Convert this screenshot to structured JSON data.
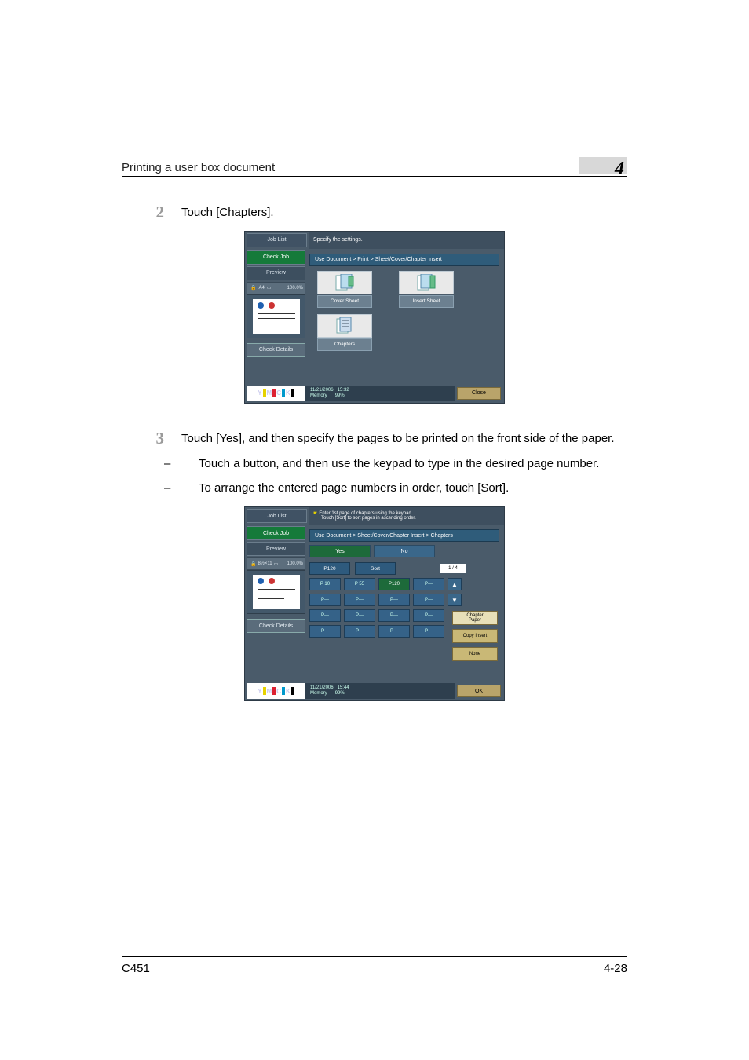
{
  "header": {
    "title": "Printing a user box document",
    "chapter_num": "4"
  },
  "footer": {
    "model": "C451",
    "page": "4-28"
  },
  "steps": {
    "s2": {
      "num": "2",
      "text": "Touch [Chapters]."
    },
    "s3": {
      "num": "3",
      "text": "Touch [Yes], and then specify the pages to be printed on the front side of the paper.",
      "sub1": "Touch a button, and then use the keypad to type in the desired page number.",
      "sub2": "To arrange the entered page numbers in order, touch [Sort]."
    }
  },
  "screen1": {
    "job_list": "Job List",
    "check_job": "Check Job",
    "preview": "Preview",
    "paper_size": "A4",
    "orient_icon": "landscape-icon",
    "zoom": "100.0%",
    "check_details": "Check Details",
    "message": "Specify the settings.",
    "breadcrumb": "Use Document > Print > Sheet/Cover/Chapter Insert",
    "btn_cover": "Cover Sheet",
    "btn_insert": "Insert Sheet",
    "btn_chapters": "Chapters",
    "date": "11/21/2006",
    "time": "15:32",
    "mem_label": "Memory",
    "mem_val": "99%",
    "close": "Close",
    "toner": {
      "y": "Y",
      "m": "M",
      "c": "C",
      "k": "K"
    }
  },
  "screen2": {
    "job_list": "Job List",
    "check_job": "Check Job",
    "preview": "Preview",
    "paper_size": "8½×11",
    "orient_icon": "landscape-icon",
    "zoom": "100.0%",
    "check_details": "Check Details",
    "message1": "Enter 1st page of chapters using the keypad.",
    "message2": "Touch [Sort] to sort pages in ascending order.",
    "breadcrumb": "Use Document > Sheet/Cover/Chapter Insert > Chapters",
    "yes": "Yes",
    "no": "No",
    "current": "P120",
    "sort": "Sort",
    "page_frac": "1 / 4",
    "cells": {
      "r1c1": "P 10",
      "r1c2": "P 55",
      "r1c3": "P120",
      "r1c4": "P---",
      "r2c1": "P---",
      "r2c2": "P---",
      "r2c3": "P---",
      "r2c4": "P---",
      "r3c1": "P---",
      "r3c2": "P---",
      "r3c3": "P---",
      "r3c4": "P---",
      "r4c1": "P---",
      "r4c2": "P---",
      "r4c3": "P---",
      "r4c4": "P---"
    },
    "arrow_up": "▲",
    "arrow_dn": "▼",
    "chapter_paper": "Chapter\nPaper",
    "copy_insert": "Copy Insert",
    "none": "None",
    "date": "11/21/2006",
    "time": "15:44",
    "mem_label": "Memory",
    "mem_val": "99%",
    "ok": "OK",
    "toner": {
      "y": "Y",
      "m": "M",
      "c": "C",
      "k": "K"
    }
  }
}
